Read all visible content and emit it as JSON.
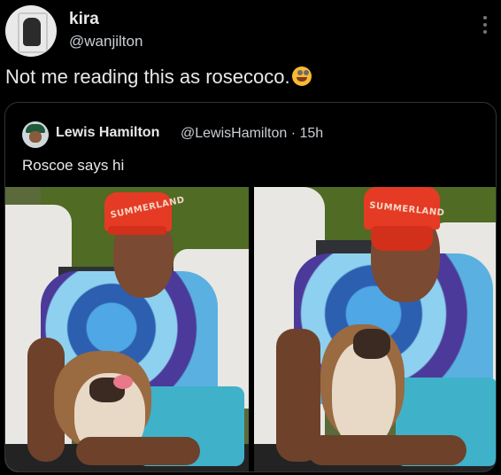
{
  "author": {
    "display_name": "kira",
    "handle": "@wanjilton"
  },
  "tweet": {
    "text": "Not me reading this as rosecoco.",
    "emoji_icon": "sneezing-face-emoji"
  },
  "quoted": {
    "display_name": "Lewis Hamilton",
    "handle_time": "@LewisHamilton · 15h",
    "text": "Roscoe says hi",
    "photos": [
      {
        "cap_text": "SUMMERLAND"
      },
      {
        "cap_text": "SUMMERLAND"
      }
    ]
  },
  "colors": {
    "background": "#000000",
    "text": "#e7e9ea",
    "secondary": "#c9cfd4",
    "border": "#2f3336"
  }
}
